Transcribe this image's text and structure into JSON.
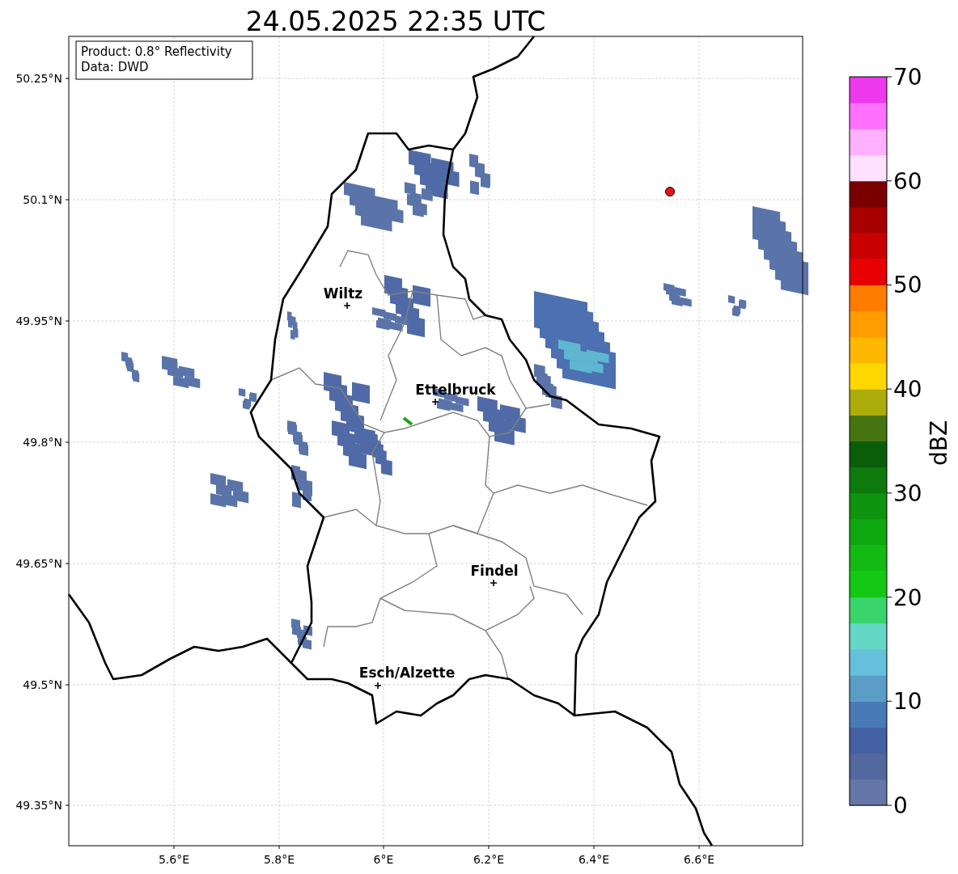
{
  "title": "24.05.2025 22:35 UTC",
  "map": {
    "info_box": [
      "Product: 0.8° Reflectivity",
      "Data: DWD"
    ],
    "y_ticks": [
      "50.25°N",
      "50.1°N",
      "49.95°N",
      "49.8°N",
      "49.65°N",
      "49.5°N",
      "49.35°N"
    ],
    "x_ticks": [
      "5.6°E",
      "5.8°E",
      "6°E",
      "6.2°E",
      "6.4°E",
      "6.6°E"
    ],
    "places": [
      {
        "name": "Wiltz"
      },
      {
        "name": "Ettelbruck"
      },
      {
        "name": "Findel"
      },
      {
        "name": "Esch/Alzette"
      }
    ]
  },
  "colorbar": {
    "label": "dBZ",
    "ticks": [
      "70",
      "60",
      "50",
      "40",
      "30",
      "20",
      "10",
      "0"
    ],
    "segments": [
      {
        "color": "#6577a8"
      },
      {
        "color": "#5468a0"
      },
      {
        "color": "#4460a5"
      },
      {
        "color": "#4a7ab5"
      },
      {
        "color": "#5a9ec8"
      },
      {
        "color": "#65c0db"
      },
      {
        "color": "#64d8c4"
      },
      {
        "color": "#3ad46c"
      },
      {
        "color": "#14c914"
      },
      {
        "color": "#14ba14"
      },
      {
        "color": "#10a810"
      },
      {
        "color": "#0e940e"
      },
      {
        "color": "#0c7a0c"
      },
      {
        "color": "#0a5e0a"
      },
      {
        "color": "#467410"
      },
      {
        "color": "#acac0a"
      },
      {
        "color": "#ffd700"
      },
      {
        "color": "#ffb800"
      },
      {
        "color": "#ff9c00"
      },
      {
        "color": "#ff7c00"
      },
      {
        "color": "#e80000"
      },
      {
        "color": "#c80000"
      },
      {
        "color": "#a80000"
      },
      {
        "color": "#7a0000"
      },
      {
        "color": "#ffe0ff"
      },
      {
        "color": "#ffb0ff"
      },
      {
        "color": "#ff70ff"
      },
      {
        "color": "#ee38ee"
      }
    ]
  }
}
